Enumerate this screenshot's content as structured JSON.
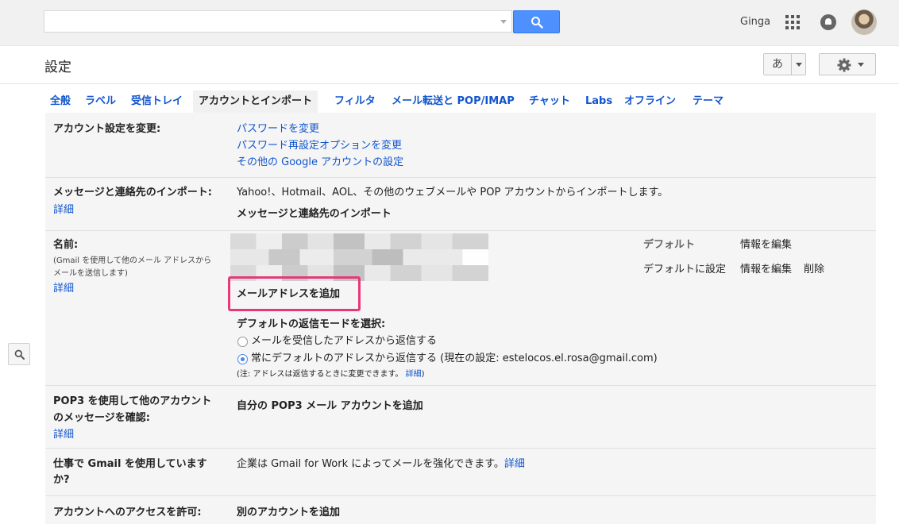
{
  "header": {
    "search_value": "",
    "user_name": "Ginga",
    "page_title": "設定",
    "input_tool_label": "あ"
  },
  "tabs": [
    {
      "label": "全般"
    },
    {
      "label": "ラベル"
    },
    {
      "label": "受信トレイ"
    },
    {
      "label": "アカウントとインポート",
      "active": true
    },
    {
      "label": "フィルタ"
    },
    {
      "label": "メール転送と POP/IMAP"
    },
    {
      "label": "チャット"
    },
    {
      "label": "Labs"
    },
    {
      "label": "オフライン"
    },
    {
      "label": "テーマ"
    }
  ],
  "sections": {
    "account": {
      "label": "アカウント設定を変更:",
      "links": [
        "パスワードを変更",
        "パスワード再設定オプションを変更",
        "その他の Google アカウントの設定"
      ]
    },
    "import": {
      "label": "メッセージと連絡先のインポート:",
      "detail": "詳細",
      "desc": "Yahoo!、Hotmail、AOL、その他のウェブメールや POP アカウントからインポートします。",
      "action": "メッセージと連絡先のインポート"
    },
    "name": {
      "label": "名前:",
      "sub1": "(Gmail を使用して他のメール アドレスから",
      "sub2": "メールを送信します)",
      "detail": "詳細",
      "default_label": "デフォルト",
      "edit_info": "情報を編集",
      "set_default": "デフォルトに設定",
      "edit_info2": "情報を編集",
      "delete": "削除",
      "add_address": "メールアドレスを追加",
      "reply_mode_title": "デフォルトの返信モードを選択:",
      "reply_option1": "メールを受信したアドレスから返信する",
      "reply_option2": "常にデフォルトのアドレスから返信する (現在の設定: estelocos.el.rosa@gmail.com)",
      "note": "(注: アドレスは返信するときに変更できます。",
      "note_link": "詳細",
      "note_end": ")"
    },
    "pop3": {
      "label1": "POP3 を使用して他のアカウント",
      "label2": "のメッセージを確認:",
      "detail": "詳細",
      "action": "自分の POP3 メール アカウントを追加"
    },
    "work": {
      "label1": "仕事で Gmail を使用していますか?",
      "label2": "",
      "desc": "企業は Gmail for Work によってメールを強化できます。",
      "link": "詳細"
    },
    "access": {
      "label": "アカウントへのアクセスを許可:",
      "action": "別のアカウントを追加"
    }
  },
  "colors": {
    "link": "#1155cc",
    "highlight": "#e8387a",
    "search_button": "#4d90fe"
  }
}
